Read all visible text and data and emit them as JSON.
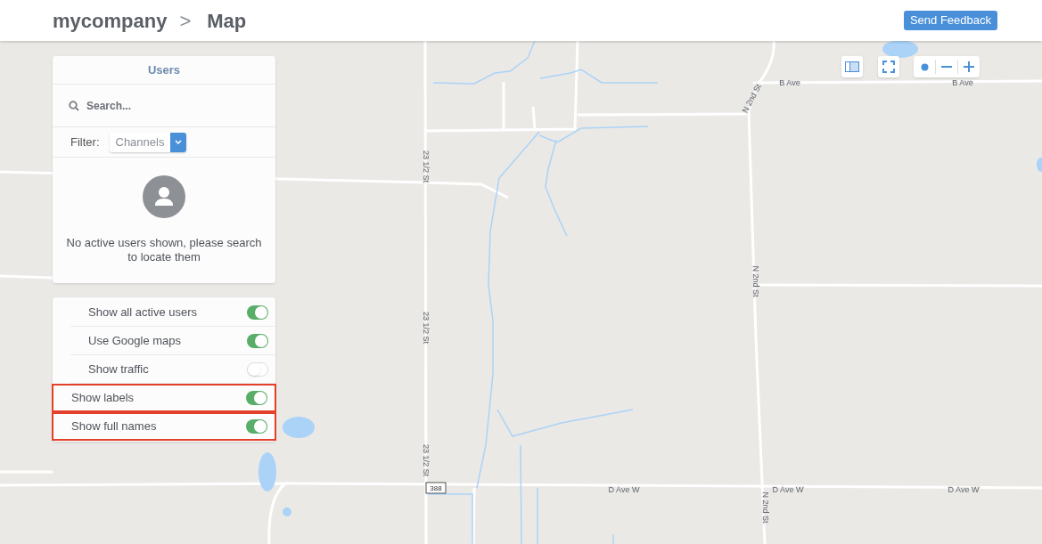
{
  "header": {
    "breadcrumb": [
      "mycompany",
      "Map"
    ],
    "separator": ">",
    "feedback_button": "Send Feedback"
  },
  "users_panel": {
    "title": "Users",
    "search": {
      "placeholder": "Search..."
    },
    "filter": {
      "label": "Filter:",
      "value": "Channels"
    },
    "empty_message": "No active users shown, please search to locate them"
  },
  "options": [
    {
      "label": "Show all active users",
      "on": true,
      "highlighted": false
    },
    {
      "label": "Use Google maps",
      "on": true,
      "highlighted": false
    },
    {
      "label": "Show traffic",
      "on": false,
      "highlighted": false
    },
    {
      "label": "Show labels",
      "on": true,
      "highlighted": true
    },
    {
      "label": "Show full names",
      "on": true,
      "highlighted": true
    }
  ],
  "map_labels": [
    {
      "text": "B Ave",
      "kind": "street"
    },
    {
      "text": "B Ave",
      "kind": "street"
    },
    {
      "text": "N 2nd St",
      "kind": "street"
    },
    {
      "text": "N 2nd St",
      "kind": "street"
    },
    {
      "text": "N 2nd St",
      "kind": "street"
    },
    {
      "text": "23 1/2 St",
      "kind": "street"
    },
    {
      "text": "23 1/2 St",
      "kind": "street"
    },
    {
      "text": "23 1/2 St",
      "kind": "street"
    },
    {
      "text": "388",
      "kind": "shield"
    },
    {
      "text": "D Ave W",
      "kind": "street"
    },
    {
      "text": "D Ave W",
      "kind": "street"
    },
    {
      "text": "D Ave W",
      "kind": "street"
    }
  ]
}
